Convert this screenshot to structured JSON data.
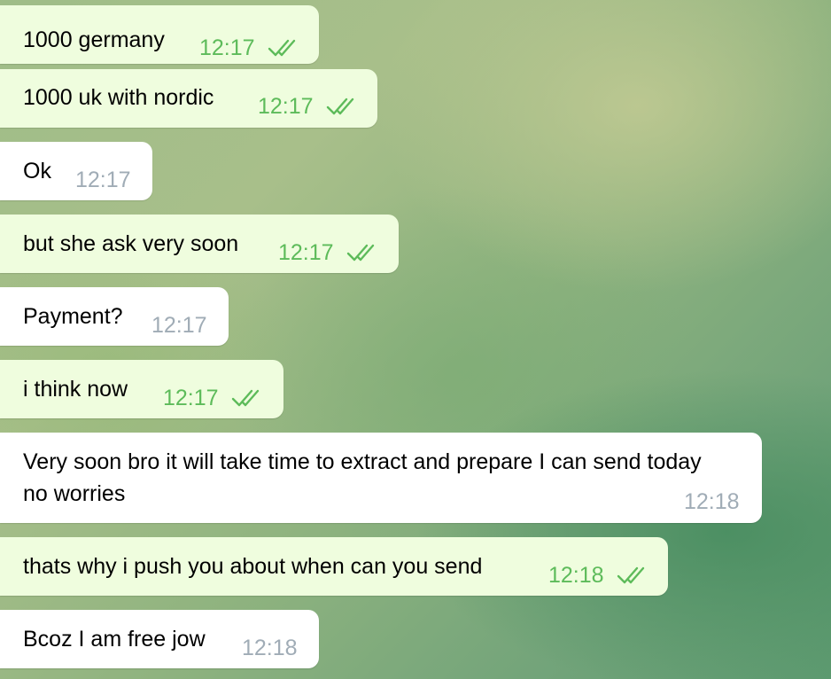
{
  "colors": {
    "outgoing_bubble": "#effdde",
    "incoming_bubble": "#ffffff",
    "outgoing_time": "#5dbb5a",
    "incoming_time": "#a0acb6",
    "read_check": "#5dbb5a"
  },
  "messages": [
    {
      "direction": "outgoing",
      "text": "1000 germany",
      "time": "12:17",
      "status_icon": "double-check-icon"
    },
    {
      "direction": "outgoing",
      "text": "1000 uk with nordic",
      "time": "12:17",
      "status_icon": "double-check-icon"
    },
    {
      "direction": "incoming",
      "text": "Ok",
      "time": "12:17"
    },
    {
      "direction": "outgoing",
      "text": "but she ask very soon",
      "time": "12:17",
      "status_icon": "double-check-icon"
    },
    {
      "direction": "incoming",
      "text": "Payment?",
      "time": "12:17"
    },
    {
      "direction": "outgoing",
      "text": "i think now",
      "time": "12:17",
      "status_icon": "double-check-icon"
    },
    {
      "direction": "incoming",
      "text": "Very soon bro it will take time to extract and prepare I can send today no worries",
      "time": "12:18"
    },
    {
      "direction": "outgoing",
      "text": "thats why i push you about when can you send",
      "time": "12:18",
      "status_icon": "double-check-icon"
    },
    {
      "direction": "incoming",
      "text": "Bcoz I am free jow",
      "time": "12:18"
    }
  ]
}
